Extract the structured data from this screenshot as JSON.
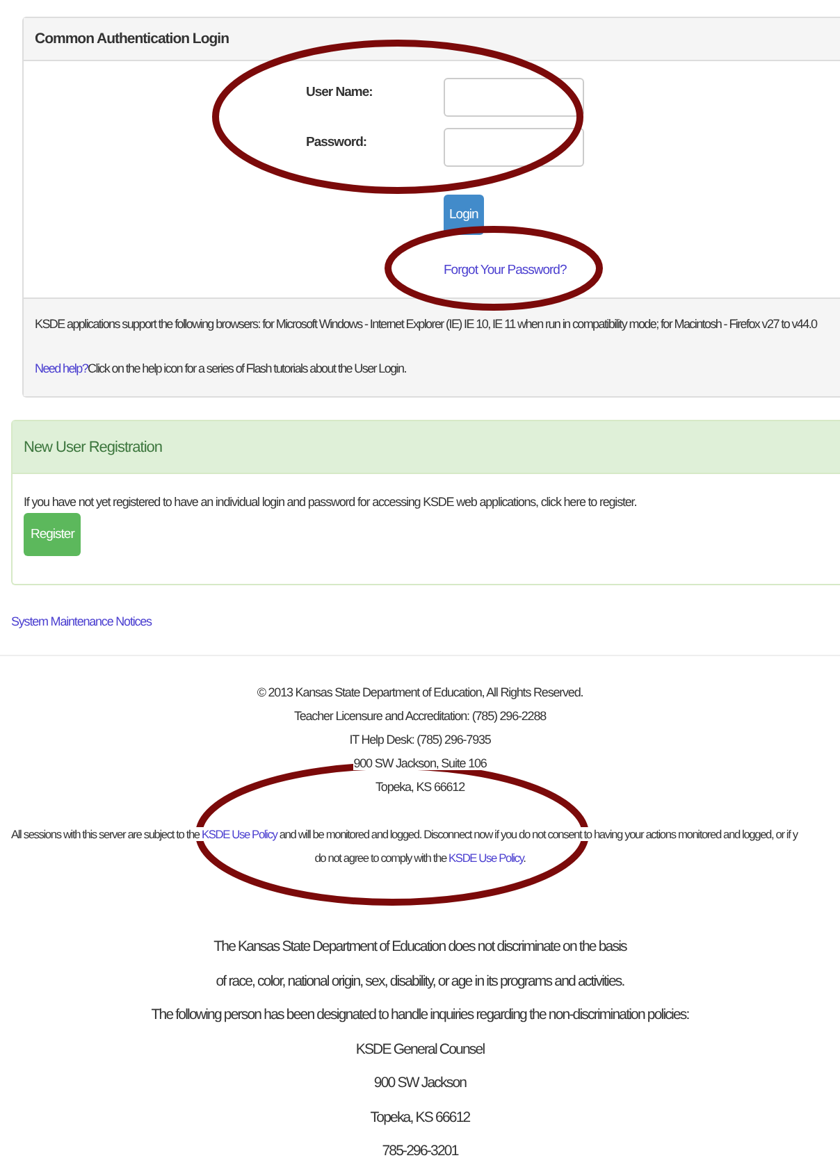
{
  "login_panel": {
    "title": "Common Authentication Login",
    "fields": [
      {
        "label": "User Name:"
      },
      {
        "label": "Password:"
      }
    ],
    "login_button": "Login",
    "forgot_link": "Forgot Your Password?",
    "browsers_note": "KSDE applications support the following browsers: for Microsoft Windows - Internet Explorer (IE) IE 10, IE 11 when run in compatibility mode; for Macintosh - Firefox v27 to v44.0",
    "help": {
      "link": "Need help?",
      "text": "Click on the help icon for a series of Flash tutorials about the User Login."
    }
  },
  "registration_panel": {
    "title": "New User Registration",
    "text": "If you have not yet registered to have an individual login and password for accessing KSDE web applications, click here to register.",
    "button": "Register"
  },
  "maintenance_link": "System Maintenance Notices",
  "footer_lines": [
    "© 2013 Kansas State Department of Education, All Rights Reserved.",
    "Teacher Licensure and Accreditation: (785) 296-2288",
    "IT Help Desk: (785) 296-7935",
    "900 SW Jackson, Suite 106",
    "Topeka, KS 66612"
  ],
  "policy_lines": [
    [
      {
        "text": "All sessions with this server are subject to the ",
        "link": false
      },
      {
        "text": "KSDE Use Policy",
        "link": true
      },
      {
        "text": " and will be monitored and logged. Disconnect now if you do not consent to having your actions monitored and logged, or if y",
        "link": false
      }
    ],
    [
      {
        "text": "do not agree to comply with the ",
        "link": false
      },
      {
        "text": "KSDE Use Policy",
        "link": true
      },
      {
        "text": ".",
        "link": false
      }
    ]
  ],
  "nondiscrimination_lines": [
    "The Kansas State Department of Education does not discriminate on the basis",
    "of race, color, national origin, sex, disability, or age in its programs and activities.",
    "The following person has been designated to handle inquiries regarding the non-discrimination policies:",
    "KSDE General Counsel",
    "900 SW Jackson",
    "Topeka, KS 66612",
    "785-296-3201"
  ]
}
